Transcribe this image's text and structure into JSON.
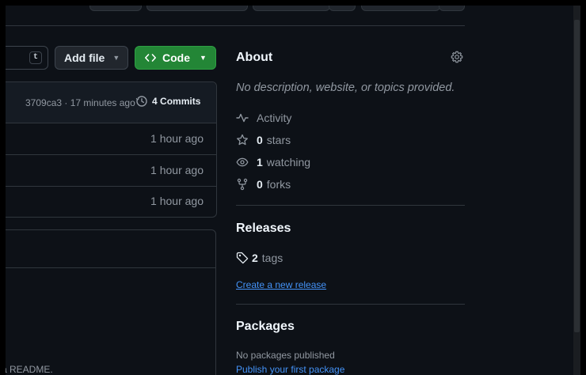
{
  "toolbar": {
    "file_search_key": "t",
    "add_file_label": "Add file",
    "code_label": "Code"
  },
  "commit_bar": {
    "hash_time": "3709ca3 · 17 minutes ago",
    "commits_count": "4",
    "commits_label": "Commits"
  },
  "files": [
    {
      "time": "1 hour ago"
    },
    {
      "time": "1 hour ago"
    },
    {
      "time": "1 hour ago"
    }
  ],
  "readme": {
    "partial_text": "a README."
  },
  "about": {
    "title": "About",
    "description": "No description, website, or topics provided.",
    "activity": "Activity",
    "stars_count": "0",
    "stars_label": "stars",
    "watching_count": "1",
    "watching_label": "watching",
    "forks_count": "0",
    "forks_label": "forks"
  },
  "releases": {
    "title": "Releases",
    "tags_count": "2",
    "tags_label": "tags",
    "create_link": "Create a new release"
  },
  "packages": {
    "title": "Packages",
    "none_text": "No packages published",
    "publish_link": "Publish your first package"
  },
  "colors": {
    "background": "#0d1117",
    "border": "#30363d",
    "green_button": "#238636",
    "link": "#4493f8",
    "muted_text": "#9198a1"
  }
}
